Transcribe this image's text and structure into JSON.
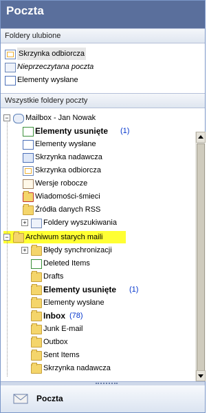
{
  "header": {
    "title": "Poczta"
  },
  "favorites": {
    "heading": "Foldery ulubione",
    "items": [
      {
        "label": "Skrzynka odbiorcza"
      },
      {
        "label": "Nieprzeczytana poczta"
      },
      {
        "label": "Elementy wysłane"
      }
    ]
  },
  "all_folders": {
    "heading": "Wszystkie foldery poczty",
    "tree": [
      {
        "label": "Mailbox - Jan Nowak",
        "count": ""
      },
      {
        "label": "Elementy usunięte",
        "count": "(1)"
      },
      {
        "label": "Elementy wysłane",
        "count": ""
      },
      {
        "label": "Skrzynka nadawcza",
        "count": ""
      },
      {
        "label": "Skrzynka odbiorcza",
        "count": ""
      },
      {
        "label": "Wersje robocze",
        "count": ""
      },
      {
        "label": "Wiadomości-śmieci",
        "count": ""
      },
      {
        "label": "Źródła danych RSS",
        "count": ""
      },
      {
        "label": "Foldery wyszukiwania",
        "count": ""
      },
      {
        "label": "Archiwum starych maili",
        "count": ""
      },
      {
        "label": "Błędy synchronizacji",
        "count": ""
      },
      {
        "label": "Deleted Items",
        "count": ""
      },
      {
        "label": "Drafts",
        "count": ""
      },
      {
        "label": "Elementy usunięte",
        "count": "(1)"
      },
      {
        "label": "Elementy wysłane",
        "count": ""
      },
      {
        "label": "Inbox",
        "count": "(78)"
      },
      {
        "label": "Junk E-mail",
        "count": ""
      },
      {
        "label": "Outbox",
        "count": ""
      },
      {
        "label": "Sent Items",
        "count": ""
      },
      {
        "label": "Skrzynka nadawcza",
        "count": ""
      }
    ]
  },
  "bottom_nav": {
    "label": "Poczta"
  },
  "colors": {
    "title_bar": "#5a6f9c",
    "highlight": "#ffff33",
    "count": "#0033cc"
  }
}
